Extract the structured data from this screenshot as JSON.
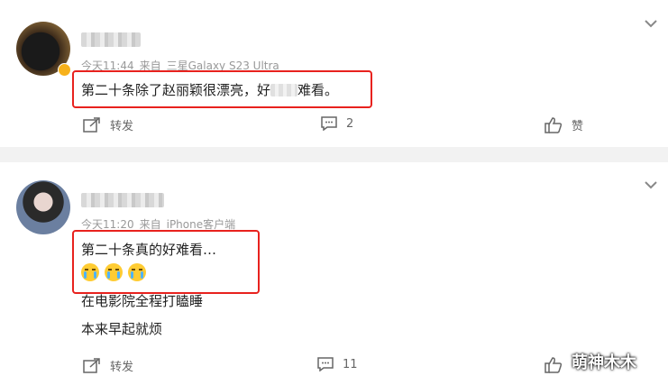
{
  "comments": [
    {
      "time": "今天11:44",
      "source_prefix": "来自",
      "source": "三星Galaxy S23 Ultra",
      "text_a": "第二十条除了赵丽颖很漂亮，好",
      "text_b": "难看。",
      "forward_label": "转发",
      "reply_count": "2",
      "like_label": "赞"
    },
    {
      "time": "今天11:20",
      "source_prefix": "来自",
      "source": "iPhone客户端",
      "lines": [
        "第二十条真的好难看…",
        "在电影院全程打瞌睡",
        "本来早起就烦"
      ],
      "forward_label": "转发",
      "reply_count": "11"
    }
  ],
  "watermark": "萌神木木",
  "icons": [
    "chevron-down-icon",
    "share-icon",
    "comment-icon",
    "thumb-up-icon",
    "crying-emoji"
  ]
}
